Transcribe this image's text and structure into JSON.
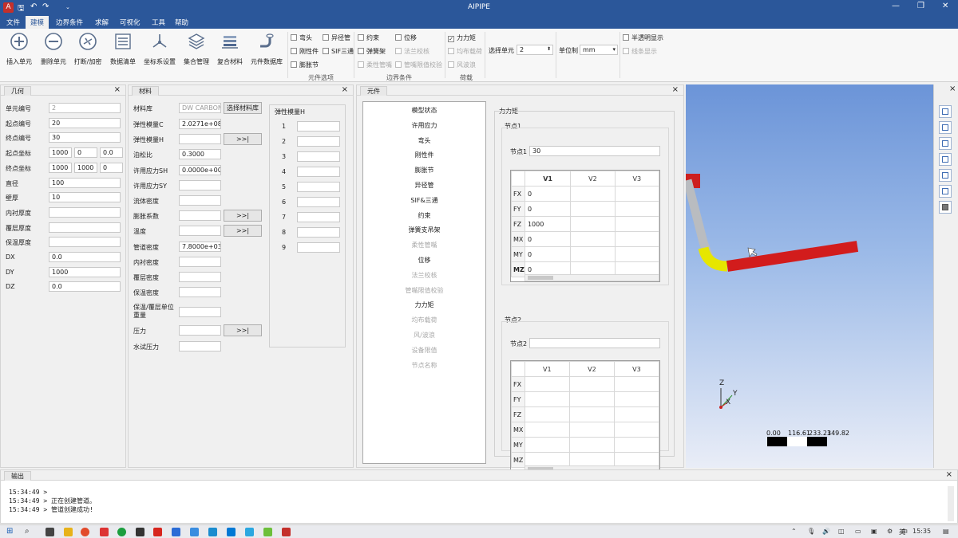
{
  "window": {
    "title": "AIPIPE",
    "minimize": "—",
    "maximize": "❐",
    "close": "✕"
  },
  "menu": [
    "文件",
    "建模",
    "边界条件",
    "求解",
    "可视化",
    "工具",
    "帮助"
  ],
  "ribbon": {
    "buttons": [
      "插入单元",
      "删除单元",
      "打断/加密",
      "数据清单",
      "坐标系设置",
      "集合管理",
      "复合材料",
      "元件数据库"
    ],
    "element_options": {
      "items": [
        "弯头",
        "异径管",
        "刚性件",
        "SIF三通",
        "膨胀节"
      ],
      "group": "元件选项"
    },
    "boundary": {
      "items": [
        "约束",
        "位移",
        "弹簧架",
        "法兰校核",
        "柔性管嘴",
        "管嘴限值校验"
      ],
      "group": "边界条件"
    },
    "load": {
      "items": [
        "力力矩",
        "均布载荷",
        "风波浪"
      ],
      "group": "荷载"
    },
    "select_unit_label": "选择单元",
    "select_unit_value": "2",
    "unit_label": "单位制",
    "unit_value": "mm",
    "display": {
      "items": [
        "半透明显示",
        "线条显示"
      ]
    }
  },
  "geometry": {
    "tab": "几何",
    "rows": [
      {
        "label": "单元编号",
        "values": [
          "2"
        ]
      },
      {
        "label": "起点编号",
        "values": [
          "20"
        ]
      },
      {
        "label": "终点编号",
        "values": [
          "30"
        ]
      },
      {
        "label": "起点坐标",
        "values": [
          "1000",
          "0",
          "0.0"
        ]
      },
      {
        "label": "终点坐标",
        "values": [
          "1000",
          "1000",
          "0"
        ]
      },
      {
        "label": "直径",
        "values": [
          "100"
        ]
      },
      {
        "label": "壁厚",
        "values": [
          "10"
        ]
      },
      {
        "label": "内衬厚度",
        "values": [
          ""
        ]
      },
      {
        "label": "覆层厚度",
        "values": [
          ""
        ]
      },
      {
        "label": "保温厚度",
        "values": [
          ""
        ]
      },
      {
        "label": "DX",
        "values": [
          "0.0"
        ]
      },
      {
        "label": "DY",
        "values": [
          "1000"
        ]
      },
      {
        "label": "DZ",
        "values": [
          "0.0"
        ]
      }
    ]
  },
  "material": {
    "tab": "材料",
    "library_label": "材料库",
    "library_value": "DW CARBON",
    "choose_button": "选择材料库",
    "arrow_button": ">>|",
    "rows": [
      {
        "label": "弹性模量C",
        "value": "2.0271e+08"
      },
      {
        "label": "弹性模量H",
        "value": ""
      },
      {
        "label": "泊松比",
        "value": "0.3000"
      },
      {
        "label": "许用应力SH",
        "value": "0.0000e+00"
      },
      {
        "label": "许用应力SY",
        "value": ""
      },
      {
        "label": "流体密度",
        "value": ""
      },
      {
        "label": "膨胀系数",
        "value": ""
      },
      {
        "label": "温度",
        "value": ""
      },
      {
        "label": "管道密度",
        "value": "7.8000e+03"
      },
      {
        "label": "内衬密度",
        "value": ""
      },
      {
        "label": "覆层密度",
        "value": ""
      },
      {
        "label": "保温密度",
        "value": ""
      },
      {
        "label": "保温/覆层单位重量",
        "value": ""
      },
      {
        "label": "压力",
        "value": ""
      },
      {
        "label": "水试压力",
        "value": ""
      }
    ],
    "elastic_title": "弹性模量H",
    "elastic_rows": [
      "1",
      "2",
      "3",
      "4",
      "5",
      "6",
      "7",
      "8",
      "9"
    ]
  },
  "component": {
    "tab": "元件",
    "list": [
      {
        "label": "模型状态",
        "enabled": true
      },
      {
        "label": "许用应力",
        "enabled": true
      },
      {
        "label": "弯头",
        "enabled": true
      },
      {
        "label": "刚性件",
        "enabled": true
      },
      {
        "label": "膨胀节",
        "enabled": true
      },
      {
        "label": "异径管",
        "enabled": true
      },
      {
        "label": "SIF&三通",
        "enabled": true
      },
      {
        "label": "约束",
        "enabled": true
      },
      {
        "label": "弹簧支吊架",
        "enabled": true
      },
      {
        "label": "柔性管嘴",
        "enabled": false
      },
      {
        "label": "位移",
        "enabled": true
      },
      {
        "label": "法兰校核",
        "enabled": false
      },
      {
        "label": "管嘴限值校验",
        "enabled": false
      },
      {
        "label": "力力矩",
        "enabled": true
      },
      {
        "label": "均布载荷",
        "enabled": false
      },
      {
        "label": "风/波浪",
        "enabled": false
      },
      {
        "label": "设备限值",
        "enabled": false
      },
      {
        "label": "节点名称",
        "enabled": false
      }
    ],
    "force_title": "力力矩",
    "node1": {
      "title": "节点1",
      "label": "节点1",
      "value": "30",
      "columns": [
        "V1",
        "V2",
        "V3"
      ],
      "rows": [
        {
          "name": "FX",
          "v1": "0"
        },
        {
          "name": "FY",
          "v1": "0"
        },
        {
          "name": "FZ",
          "v1": "1000"
        },
        {
          "name": "MX",
          "v1": "0"
        },
        {
          "name": "MY",
          "v1": "0"
        },
        {
          "name": "MZ",
          "v1": "0"
        }
      ]
    },
    "node2": {
      "title": "节点2",
      "label": "节点2",
      "value": "",
      "columns": [
        "V1",
        "V2",
        "V3"
      ],
      "rows": [
        {
          "name": "FX",
          "v1": ""
        },
        {
          "name": "FY",
          "v1": ""
        },
        {
          "name": "FZ",
          "v1": ""
        },
        {
          "name": "MX",
          "v1": ""
        },
        {
          "name": "MY",
          "v1": ""
        },
        {
          "name": "MZ",
          "v1": ""
        }
      ]
    }
  },
  "viewport": {
    "scale_labels": [
      "0.00",
      "116.61",
      "233.21",
      "349.82"
    ],
    "axes": {
      "z": "Z",
      "y": "Y",
      "x": "X"
    }
  },
  "output": {
    "tab": "输出",
    "lines": [
      "15:34:49 >",
      "15:34:49 > 正在创建管道。",
      "15:34:49 > 管道创建成功!"
    ]
  },
  "taskbar": {
    "lang": "英",
    "time": "15:35"
  }
}
